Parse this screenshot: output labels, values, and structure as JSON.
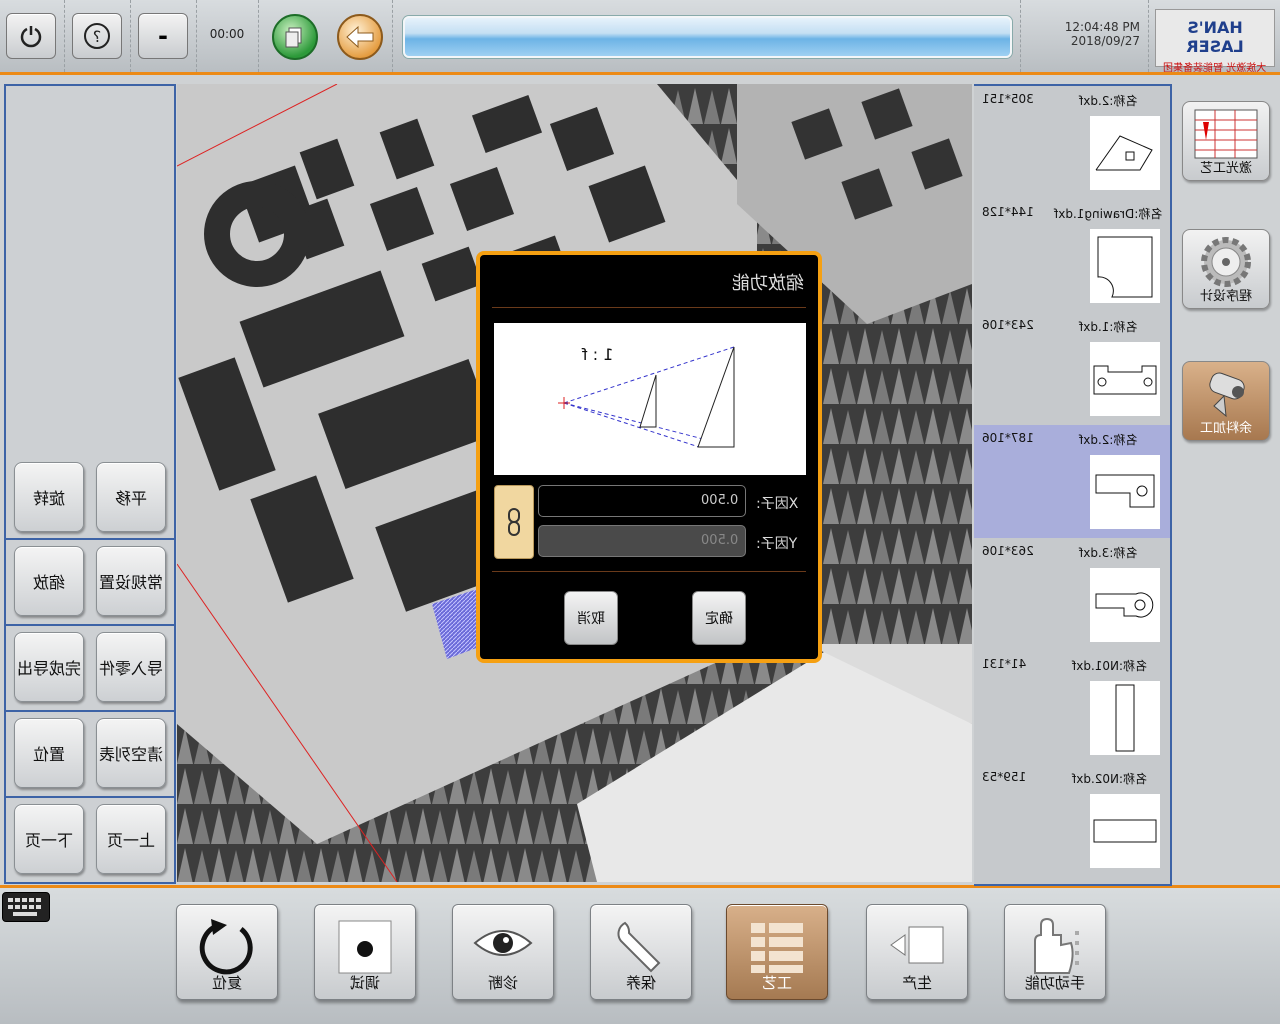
{
  "topbar": {
    "power_icon": "power-icon",
    "help_icon": "help-icon",
    "minimize_label": "-",
    "timer": "00:00",
    "time": "12:04:48 PM",
    "date": "2018/09/27",
    "logo_text_top": "HAN'S LASER",
    "logo_text_bottom": "大族激光 智能装备集团"
  },
  "left_panel": {
    "buttons": [
      {
        "label": "平移"
      },
      {
        "label": "旋转"
      },
      {
        "label": "常规设置"
      },
      {
        "label": "缩放"
      },
      {
        "label": "导入零件"
      },
      {
        "label": "完成导出"
      },
      {
        "label": "清空列表"
      },
      {
        "label": "置位"
      },
      {
        "label": "上一页"
      },
      {
        "label": "下一页"
      }
    ]
  },
  "parts": [
    {
      "name": "名称:2.dxf",
      "size": "305*151"
    },
    {
      "name": "名称:Drawing1.dxf",
      "size": "144*128"
    },
    {
      "name": "名称:1.dxf",
      "size": "243*106"
    },
    {
      "name": "名称:2.dxf",
      "size": "187*106"
    },
    {
      "name": "名称:3.dxf",
      "size": "263*106"
    },
    {
      "name": "名称:N01.dxf",
      "size": "41*131"
    },
    {
      "name": "名称:N02.dxf",
      "size": "159*53"
    }
  ],
  "right_nav": [
    {
      "label": "激光工艺"
    },
    {
      "label": "程序设计"
    },
    {
      "label": "余料加工"
    }
  ],
  "bottom_nav": [
    {
      "label": "复位"
    },
    {
      "label": "调试"
    },
    {
      "label": "诊断"
    },
    {
      "label": "保养"
    },
    {
      "label": "工艺"
    },
    {
      "label": "生产"
    },
    {
      "label": "手动功能"
    }
  ],
  "dialog": {
    "title": "缩放功能",
    "ratio": "1 : f",
    "x_label": "X因子:",
    "y_label": "Y因子:",
    "x_value": "0.500",
    "y_value": "0.500",
    "confirm": "确定",
    "cancel": "取消"
  },
  "colors": {
    "accent_orange": "#ec8a16",
    "frame_blue": "#3d63a6",
    "selected_row": "#a9aedb"
  }
}
